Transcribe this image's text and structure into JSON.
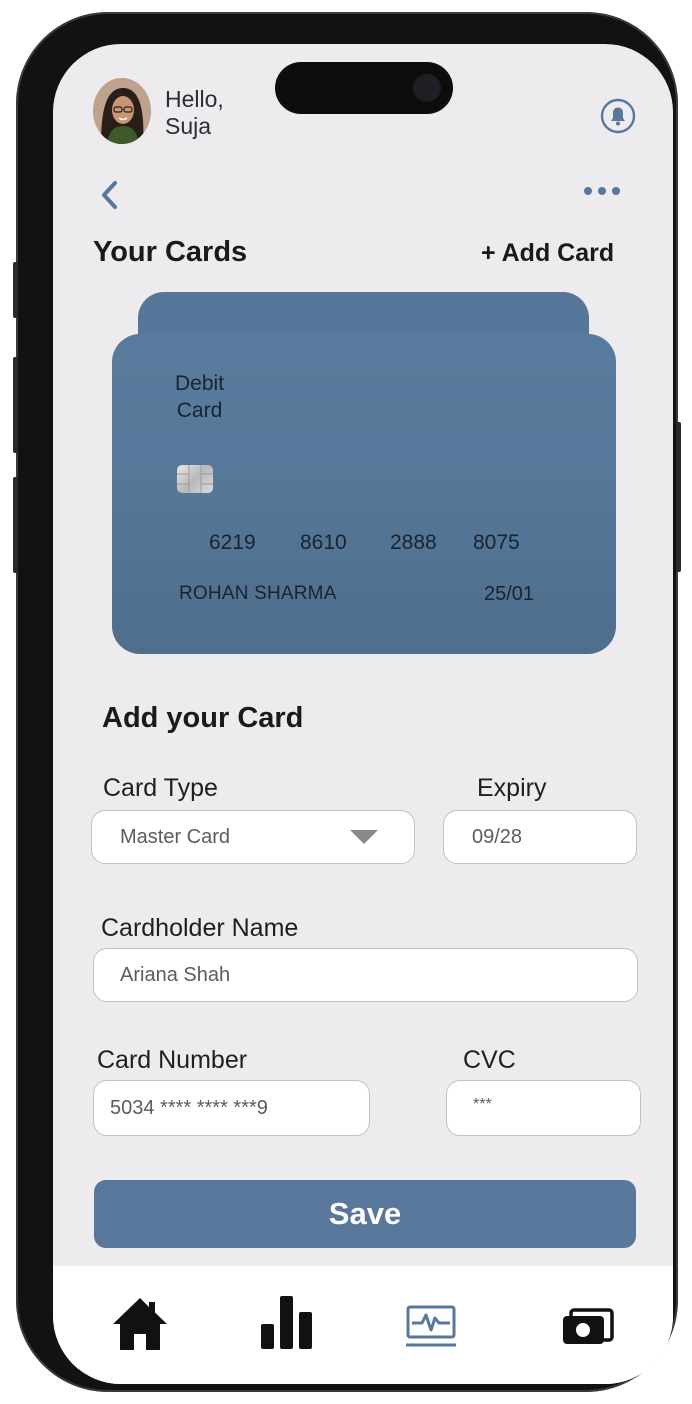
{
  "header": {
    "greeting_hello": "Hello,",
    "greeting_name": "Suja",
    "avatar_icon": "user-avatar",
    "bell_icon": "notification-bell-icon"
  },
  "nav": {
    "back_icon": "chevron-left-icon",
    "more_icon": "more-horizontal-icon"
  },
  "cards": {
    "title": "Your Cards",
    "add_label": "+ Add Card"
  },
  "card": {
    "type_line1": "Debit",
    "type_line2": "Card",
    "number": [
      "6219",
      "8610",
      "2888",
      "8075"
    ],
    "holder": "ROHAN SHARMA",
    "expiry": "25/01"
  },
  "form": {
    "title": "Add your Card",
    "card_type_label": "Card Type",
    "card_type_value": "Master Card",
    "expiry_label": "Expiry",
    "expiry_value": "09/28",
    "holder_label": "Cardholder Name",
    "holder_value": "Ariana Shah",
    "number_label": "Card Number",
    "number_value": "5034 **** **** ***9",
    "cvc_label": "CVC",
    "cvc_value": "***",
    "save_label": "Save"
  },
  "tabbar": {
    "items": [
      {
        "icon": "home-icon",
        "active": false
      },
      {
        "icon": "bar-chart-icon",
        "active": false
      },
      {
        "icon": "activity-monitor-icon",
        "active": true
      },
      {
        "icon": "wallet-cash-icon",
        "active": false
      }
    ]
  },
  "colors": {
    "accent": "#58779a",
    "background": "#eeebee",
    "text": "#1a1a1a"
  }
}
